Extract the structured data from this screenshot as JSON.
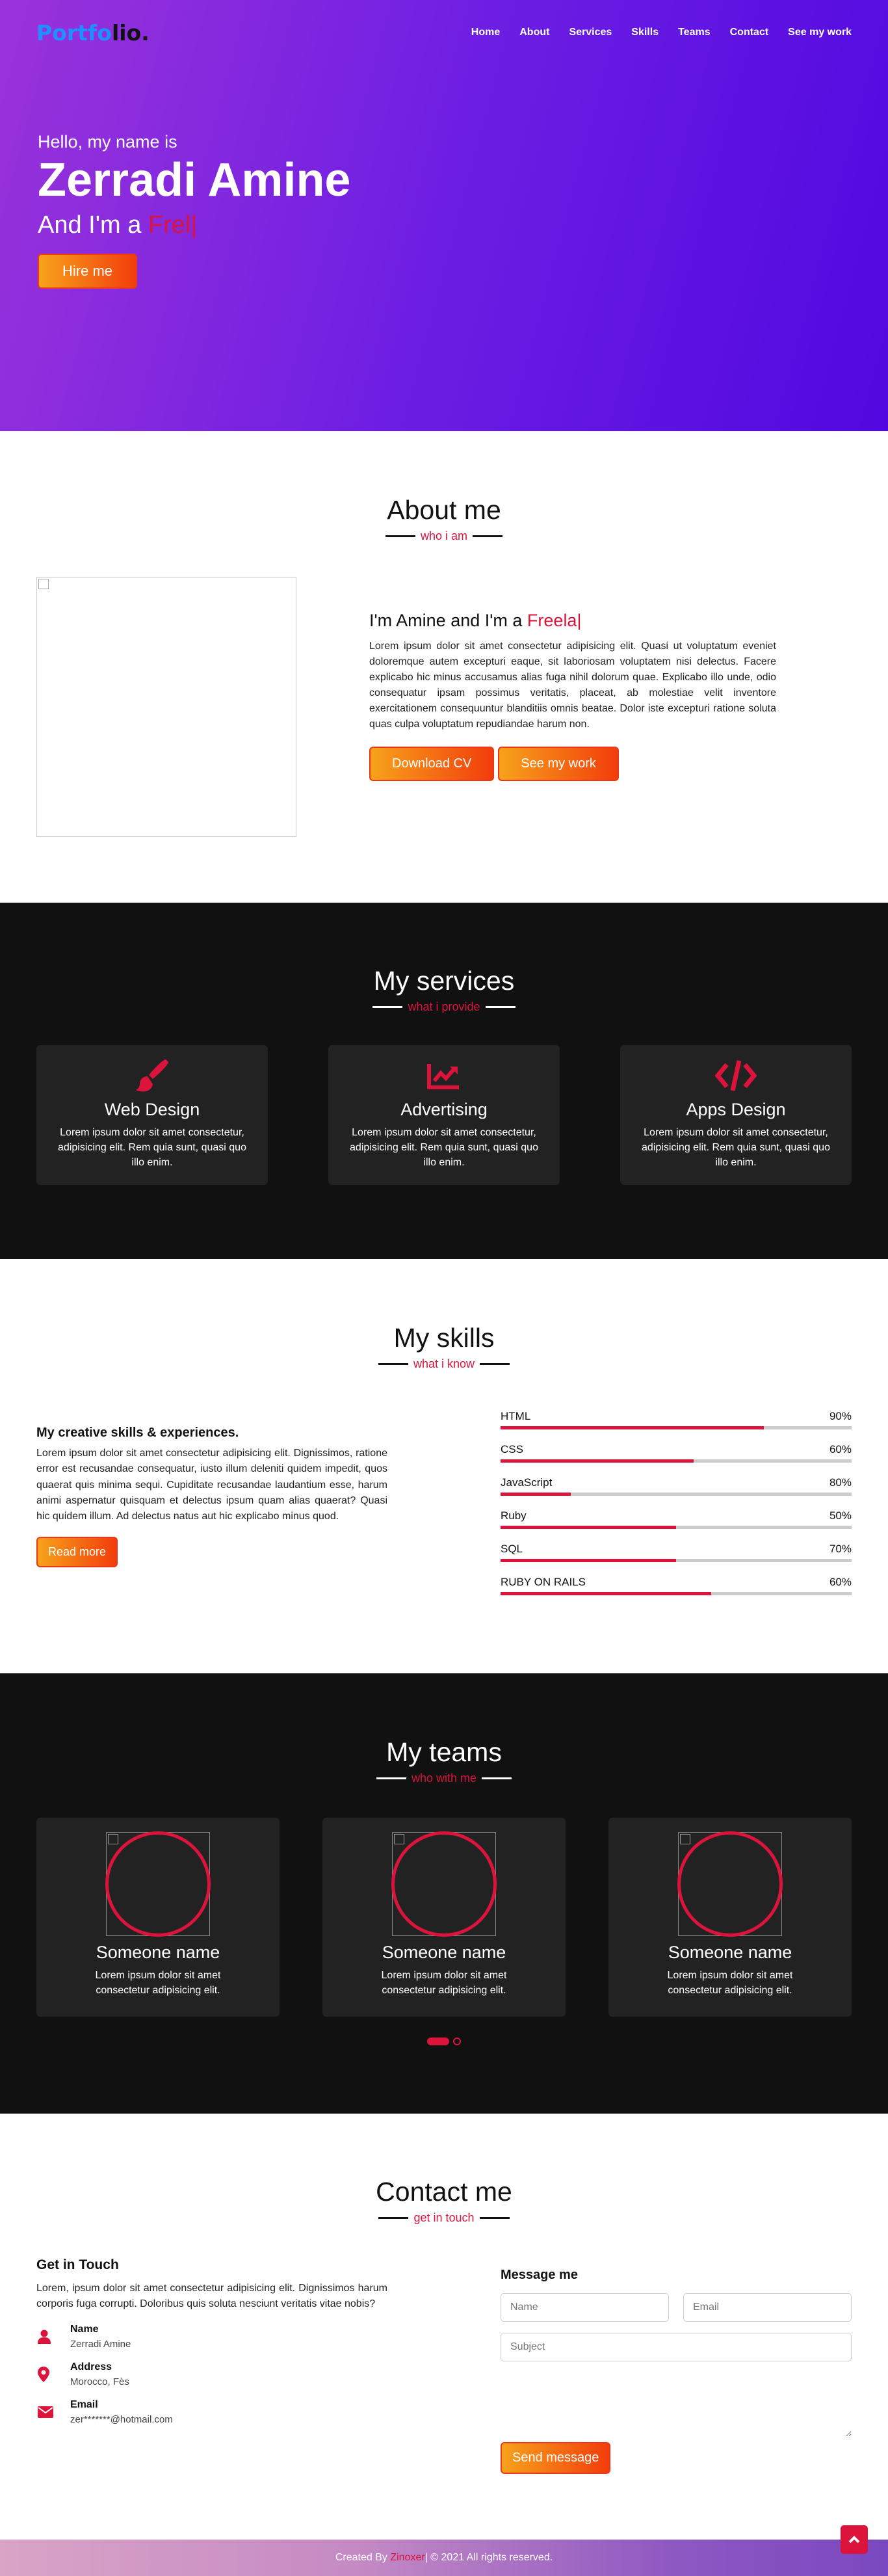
{
  "nav": {
    "logo_part1": "Portfo",
    "logo_part2": "lio",
    "logo_dot": ".",
    "items": [
      {
        "label": "Home"
      },
      {
        "label": "About"
      },
      {
        "label": "Services"
      },
      {
        "label": "Skills"
      },
      {
        "label": "Teams"
      },
      {
        "label": "Contact"
      },
      {
        "label": "See my work"
      }
    ]
  },
  "home": {
    "greeting": "Hello, my name is",
    "name": "Zerradi Amine",
    "role_prefix": "And I'm a ",
    "role_typed": "Frel",
    "caret": "|",
    "hire_label": "Hire me"
  },
  "about": {
    "title": "About me",
    "subtitle": "who i am",
    "heading_prefix": "I'm Amine and I'm a ",
    "heading_typed": "Freela",
    "caret": "|",
    "paragraph": "Lorem ipsum dolor sit amet consectetur adipisicing elit. Quasi ut voluptatum eveniet doloremque autem excepturi eaque, sit laboriosam voluptatem nisi delectus. Facere explicabo hic minus accusamus alias fuga nihil dolorum quae. Explicabo illo unde, odio consequatur ipsam possimus veritatis, placeat, ab molestiae velit inventore exercitationem consequuntur blanditiis omnis beatae. Dolor iste excepturi ratione soluta quas culpa voluptatum repudiandae harum non.",
    "download_label": "Download CV",
    "work_label": "See my work"
  },
  "services": {
    "title": "My services",
    "subtitle": "what i provide",
    "cards": [
      {
        "icon": "paint-brush-icon",
        "title": "Web Design",
        "text": "Lorem ipsum dolor sit amet consectetur, adipisicing elit. Rem quia sunt, quasi quo illo enim."
      },
      {
        "icon": "chart-line-icon",
        "title": "Advertising",
        "text": "Lorem ipsum dolor sit amet consectetur, adipisicing elit. Rem quia sunt, quasi quo illo enim."
      },
      {
        "icon": "code-icon",
        "title": "Apps Design",
        "text": "Lorem ipsum dolor sit amet consectetur, adipisicing elit. Rem quia sunt, quasi quo illo enim."
      }
    ]
  },
  "skills": {
    "title": "My skills",
    "subtitle": "what i know",
    "heading": "My creative skills & experiences.",
    "paragraph": "Lorem ipsum dolor sit amet consectetur adipisicing elit. Dignissimos, ratione error est recusandae consequatur, iusto illum deleniti quidem impedit, quos quaerat quis minima sequi. Cupiditate recusandae laudantium esse, harum animi aspernatur quisquam et delectus ipsum quam alias quaerat? Quasi hic quidem illum. Ad delectus natus aut hic explicabo minus quod.",
    "read_more_label": "Read more",
    "bars": [
      {
        "name": "HTML",
        "label": "90%",
        "level": 0.75
      },
      {
        "name": "CSS",
        "label": "60%",
        "level": 0.55
      },
      {
        "name": "JavaScript",
        "label": "80%",
        "level": 0.2
      },
      {
        "name": "Ruby",
        "label": "50%",
        "level": 0.5
      },
      {
        "name": "SQL",
        "label": "70%",
        "level": 0.5
      },
      {
        "name": "RUBY ON RAILS",
        "label": "60%",
        "level": 0.6
      }
    ]
  },
  "teams": {
    "title": "My teams",
    "subtitle": "who with me",
    "members": [
      {
        "name": "Someone name",
        "text": "Lorem ipsum dolor sit amet consectetur adipisicing elit."
      },
      {
        "name": "Someone name",
        "text": "Lorem ipsum dolor sit amet consectetur adipisicing elit."
      },
      {
        "name": "Someone name",
        "text": "Lorem ipsum dolor sit amet consectetur adipisicing elit."
      }
    ]
  },
  "contact": {
    "title": "Contact me",
    "subtitle": "get in touch",
    "left_heading": "Get in Touch",
    "left_text": "Lorem, ipsum dolor sit amet consectetur adipisicing elit. Dignissimos harum corporis fuga corrupti. Doloribus quis soluta nesciunt veritatis vitae nobis?",
    "info": [
      {
        "icon": "user-icon",
        "label": "Name",
        "value": "Zerradi Amine"
      },
      {
        "icon": "map-marker-icon",
        "label": "Address",
        "value": "Morocco, Fès"
      },
      {
        "icon": "envelope-icon",
        "label": "Email",
        "value": "zer*******@hotmail.com"
      }
    ],
    "right_heading": "Message me",
    "name_placeholder": "Name",
    "email_placeholder": "Email",
    "subject_placeholder": "Subject",
    "send_label": "Send message"
  },
  "footer": {
    "prefix": "Created By ",
    "author": "Zinoxer",
    "suffix": " | © 2021 All rights reserved."
  },
  "colors": {
    "accent": "#dc143c",
    "dark": "#111111",
    "card": "#222222"
  }
}
